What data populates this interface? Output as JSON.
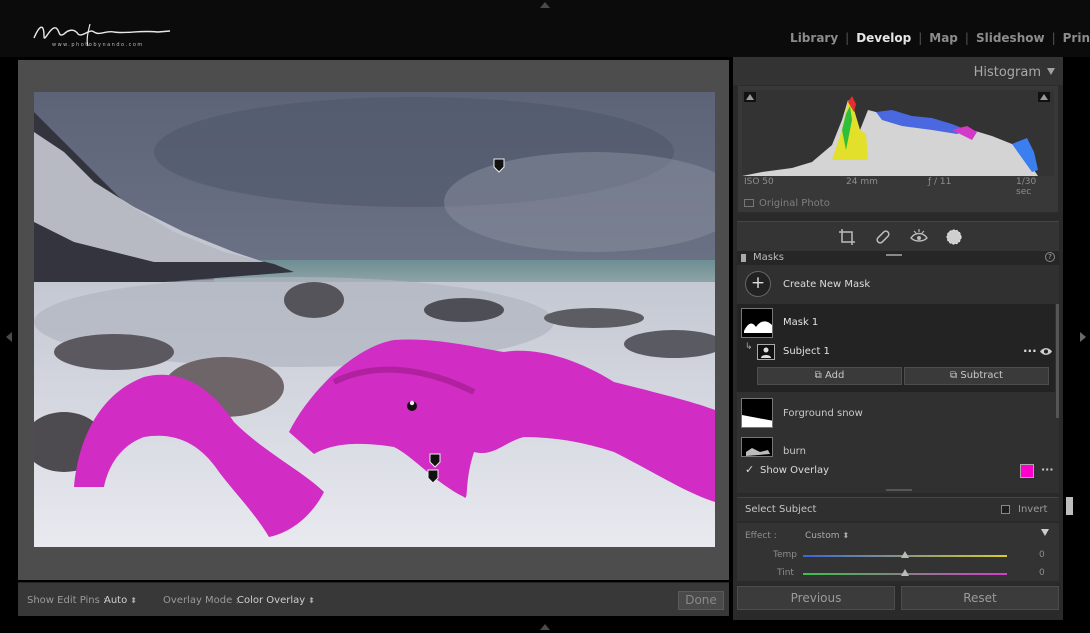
{
  "app": {
    "logo_text": "Nando Harmsen",
    "logo_subtext": "www.photobynando.com"
  },
  "modules": [
    "Library",
    "Develop",
    "Map",
    "Slideshow",
    "Prin"
  ],
  "active_module": "Develop",
  "toolbar": {
    "show_edit_pins_label": "Show Edit Pins :",
    "show_edit_pins_value": "Auto",
    "overlay_mode_label": "Overlay Mode :",
    "overlay_mode_value": "Color Overlay",
    "done_label": "Done"
  },
  "histogram": {
    "title": "Histogram",
    "iso": "ISO 50",
    "focal": "24 mm",
    "aperture": "ƒ / 11",
    "shutter": "1/30 sec",
    "original_photo_label": "Original Photo"
  },
  "tools": [
    "crop-icon",
    "heal-icon",
    "redeye-icon",
    "mask-icon"
  ],
  "masks": {
    "header": "Masks",
    "create_label": "Create New Mask",
    "items": [
      {
        "name": "Mask 1"
      },
      {
        "name": "Subject 1"
      },
      {
        "name": "Forground snow"
      },
      {
        "name": "burn"
      }
    ],
    "add_label": "Add",
    "subtract_label": "Subtract",
    "show_overlay_label": "Show Overlay",
    "overlay_color": "#ff00cc"
  },
  "select_subject": {
    "label": "Select Subject",
    "invert_label": "Invert"
  },
  "effect": {
    "label": "Effect :",
    "preset": "Custom",
    "temp_label": "Temp",
    "temp_value": "0",
    "tint_label": "Tint",
    "tint_value": "0"
  },
  "buttons": {
    "previous": "Previous",
    "reset": "Reset"
  }
}
